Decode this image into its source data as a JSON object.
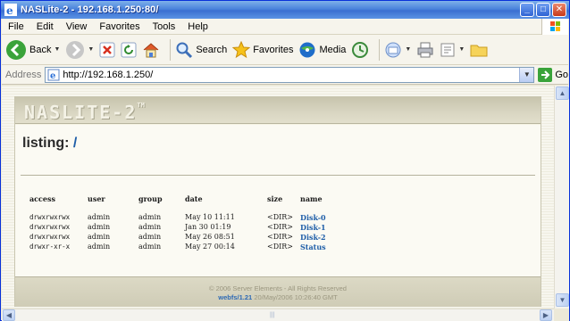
{
  "window": {
    "title": "NASLite-2 - 192.168.1.250:80/"
  },
  "menubar": {
    "items": [
      "File",
      "Edit",
      "View",
      "Favorites",
      "Tools",
      "Help"
    ]
  },
  "toolbar": {
    "back_label": "Back",
    "search_label": "Search",
    "favorites_label": "Favorites",
    "media_label": "Media"
  },
  "address": {
    "label": "Address",
    "url": "http://192.168.1.250/",
    "go_label": "Go"
  },
  "page": {
    "logo": "NASLITE-2",
    "logo_tm": "TM",
    "listing_label": "listing:",
    "listing_path": "/",
    "columns": [
      "access",
      "user",
      "group",
      "date",
      "size",
      "name"
    ],
    "rows": [
      {
        "access": "drwxrwxrwx",
        "user": "admin",
        "group": "admin",
        "date": "May 10 11:11",
        "size": "<DIR>",
        "name": "Disk-0"
      },
      {
        "access": "drwxrwxrwx",
        "user": "admin",
        "group": "admin",
        "date": "Jan 30 01:19",
        "size": "<DIR>",
        "name": "Disk-1"
      },
      {
        "access": "drwxrwxrwx",
        "user": "admin",
        "group": "admin",
        "date": "May 26 08:51",
        "size": "<DIR>",
        "name": "Disk-2"
      },
      {
        "access": "drwxr-xr-x",
        "user": "admin",
        "group": "admin",
        "date": "May 27 00:14",
        "size": "<DIR>",
        "name": "Status"
      }
    ],
    "footer_copyright": "© 2006 Server Elements - All Rights Reserved",
    "footer_version": "webfs/1.21",
    "footer_timestamp": "20/May/2006 10:26:40 GMT"
  }
}
